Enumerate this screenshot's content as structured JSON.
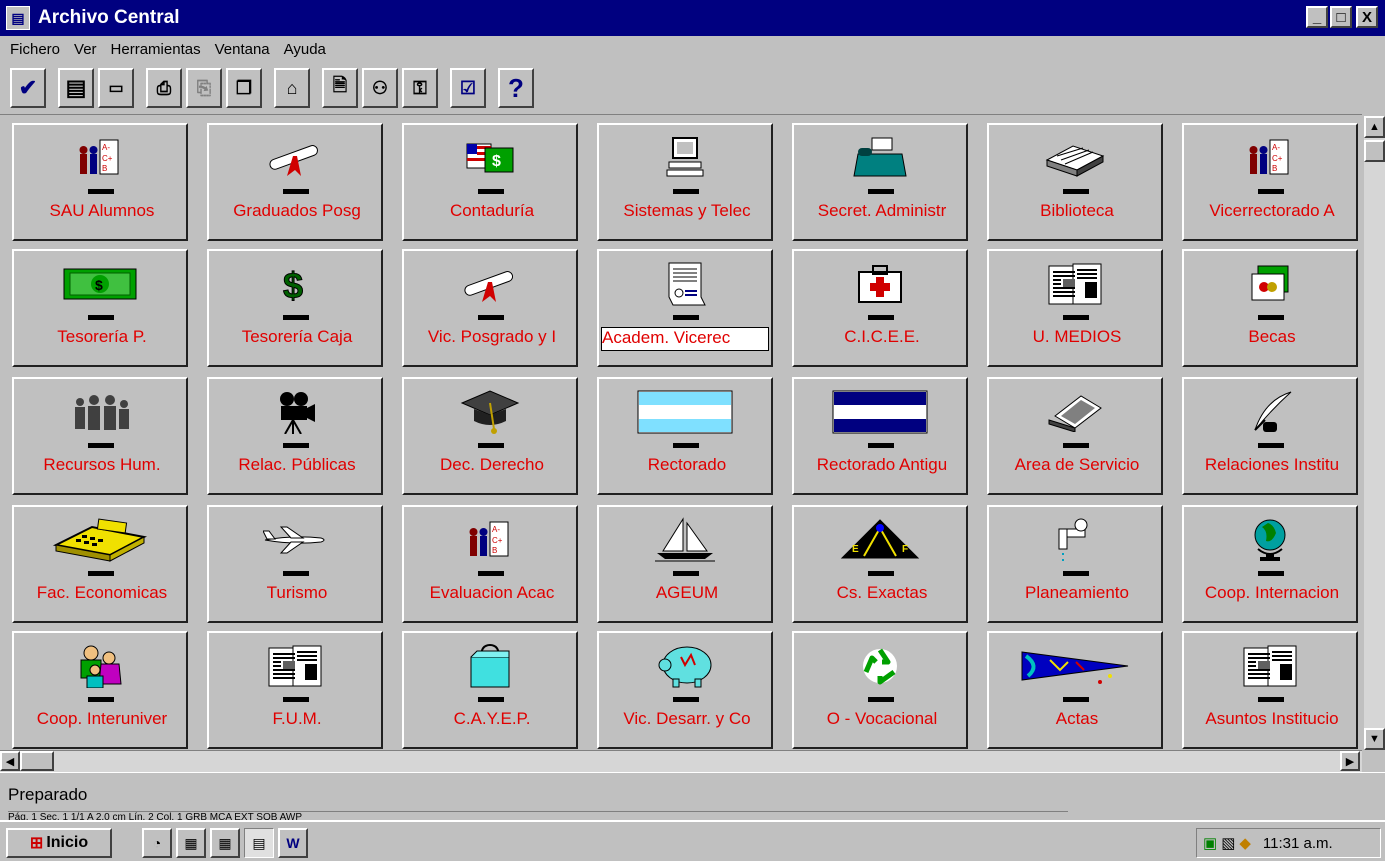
{
  "window": {
    "title": "Archivo Central",
    "min": "_",
    "max": "□",
    "close": "X"
  },
  "menu": [
    "Fichero",
    "Ver",
    "Herramientas",
    "Ventana",
    "Ayuda"
  ],
  "toolbar": {
    "help": "?"
  },
  "tiles": [
    [
      "SAU Alumnos",
      "Graduados Posg",
      "Contaduría",
      "Sistemas y Telec",
      "Secret. Administr",
      "Biblioteca",
      "Vicerrectorado A"
    ],
    [
      "Tesorería P.",
      "Tesorería Caja",
      "Vic. Posgrado y I",
      "Academ. Vicerec",
      "C.I.C.E.E.",
      "U. MEDIOS",
      "Becas"
    ],
    [
      "Recursos Hum.",
      "Relac. Públicas",
      "Dec. Derecho",
      "Rectorado",
      "Rectorado Antigu",
      "Area de Servicio",
      "Relaciones Institu"
    ],
    [
      "Fac. Economicas",
      "Turismo",
      "Evaluacion Acac",
      "AGEUM",
      "Cs. Exactas",
      "Planeamiento",
      "Coop. Internacion"
    ],
    [
      "Coop. Interuniver",
      "F.U.M.",
      "C.A.Y.E.P.",
      "Vic. Desarr. y Co",
      "O  - Vocacional",
      "Actas",
      "Asuntos Institucio"
    ]
  ],
  "icons": [
    [
      "students-grades-icon",
      "diploma-icon",
      "money-flags-icon",
      "computer-icon",
      "fax-icon",
      "library-icon",
      "students-grades-icon"
    ],
    [
      "banknote-icon",
      "dollar-icon",
      "diploma-icon",
      "certificate-icon",
      "first-aid-icon",
      "newspaper-icon",
      "cards-icon"
    ],
    [
      "people-icon",
      "movie-camera-icon",
      "graduation-cap-icon",
      "flag-argentina-icon",
      "flag-blue-icon",
      "laptop-icon",
      "quill-ink-icon"
    ],
    [
      "cash-register-icon",
      "airplane-icon",
      "students-grades-icon",
      "sailboat-icon",
      "math-compass-icon",
      "faucet-icon",
      "globe-icon"
    ],
    [
      "family-icon",
      "newspaper-icon",
      "shopping-bag-icon",
      "piggy-bank-icon",
      "recycle-icon",
      "pennant-icon",
      "newspaper-icon"
    ]
  ],
  "status": {
    "ready": "Preparado",
    "cells": "Pág. 1      Sec. 1        1/1        A  2.0 cm    Lín. 2      Col. 1                                 GRB   MCA   EXT   SOB   AWP"
  },
  "taskbar": {
    "start": "Inicio",
    "clock": "11:31 a.m."
  },
  "colors": {
    "title_bg": "#000080",
    "label_red": "#e00000",
    "face": "#c0c0c0"
  }
}
